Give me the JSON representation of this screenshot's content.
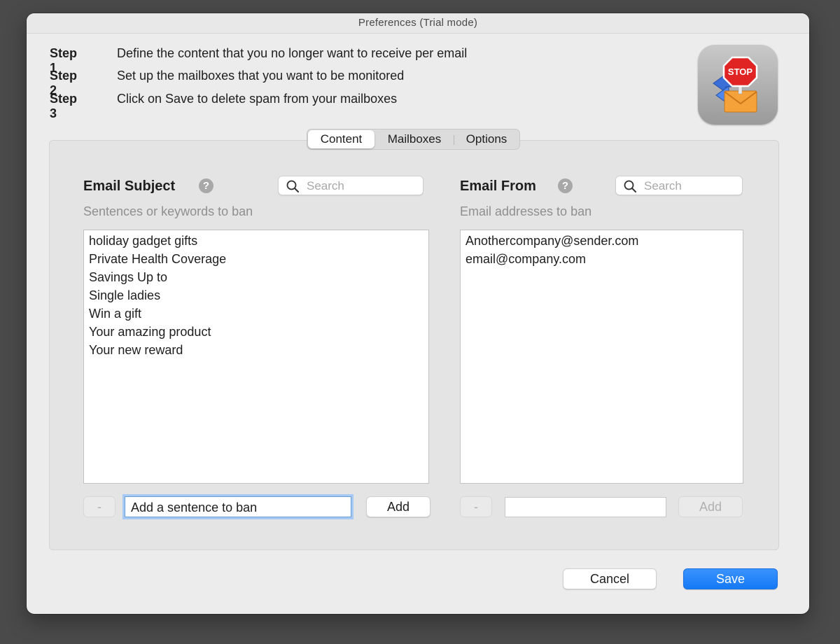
{
  "window": {
    "title": "Preferences (Trial mode)"
  },
  "steps": [
    {
      "label": "Step 1",
      "text": "Define the content that you no longer want to receive per email"
    },
    {
      "label": "Step 2",
      "text": "Set up the mailboxes that you want to be monitored"
    },
    {
      "label": "Step 3",
      "text": "Click on Save to delete spam from your mailboxes"
    }
  ],
  "app_icon": {
    "name": "stop-mail-icon",
    "sign_text": "STOP"
  },
  "tabs": [
    {
      "label": "Content",
      "active": true
    },
    {
      "label": "Mailboxes",
      "active": false
    },
    {
      "label": "Options",
      "active": false
    }
  ],
  "subject": {
    "heading": "Email Subject",
    "help": "?",
    "search_placeholder": "Search",
    "subtext": "Sentences or keywords to ban",
    "items": [
      "holiday gadget gifts",
      "Private Health Coverage",
      "Savings Up to",
      "Single ladies",
      "Win a gift",
      "Your amazing product",
      "Your new reward"
    ],
    "remove_label": "-",
    "input_value": "Add a sentence to ban",
    "add_label": "Add"
  },
  "from": {
    "heading": "Email From",
    "help": "?",
    "search_placeholder": "Search",
    "subtext": "Email addresses to ban",
    "items": [
      "Anothercompany@sender.com",
      "email@company.com"
    ],
    "remove_label": "-",
    "input_value": "",
    "add_label": "Add"
  },
  "footer": {
    "cancel_label": "Cancel",
    "save_label": "Save"
  },
  "colors": {
    "accent": "#1579f5",
    "panel": "#e4e4e4",
    "window": "#ececec"
  }
}
